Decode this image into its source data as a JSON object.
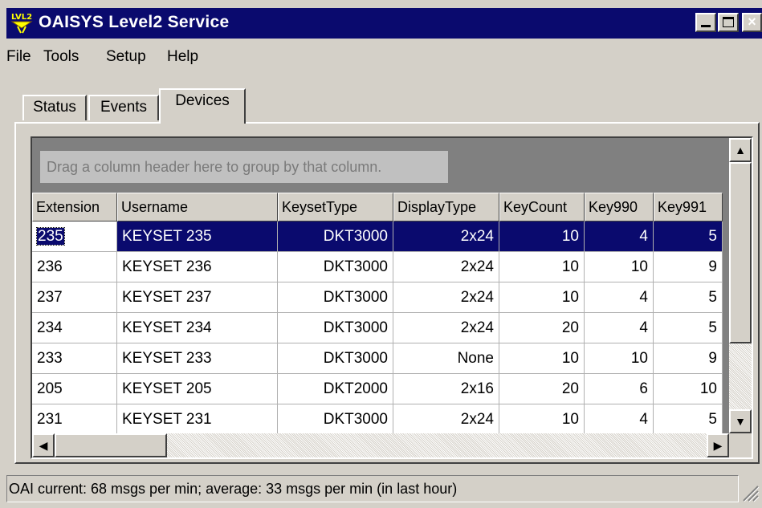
{
  "window": {
    "title": "OAISYS Level2 Service",
    "icon": "lvl2-app-icon",
    "controls": {
      "minimize": "_",
      "maximize": "□",
      "close": "×"
    }
  },
  "menu": {
    "items": [
      "File",
      "Tools",
      "Setup",
      "Help"
    ]
  },
  "tabs": {
    "items": [
      "Status",
      "Events",
      "Devices"
    ],
    "active": "Devices"
  },
  "grid": {
    "group_hint": "Drag a column header here to group by that column.",
    "columns": [
      "Extension",
      "Username",
      "KeysetType",
      "DisplayType",
      "KeyCount",
      "Key990",
      "Key991"
    ],
    "selected_row": 0,
    "rows": [
      [
        "235",
        "KEYSET 235",
        "DKT3000",
        "2x24",
        "10",
        "4",
        "5"
      ],
      [
        "236",
        "KEYSET 236",
        "DKT3000",
        "2x24",
        "10",
        "10",
        "9"
      ],
      [
        "237",
        "KEYSET 237",
        "DKT3000",
        "2x24",
        "10",
        "4",
        "5"
      ],
      [
        "234",
        "KEYSET 234",
        "DKT3000",
        "2x24",
        "20",
        "4",
        "5"
      ],
      [
        "233",
        "KEYSET 233",
        "DKT3000",
        "None",
        "10",
        "10",
        "9"
      ],
      [
        "205",
        "KEYSET 205",
        "DKT2000",
        "2x16",
        "20",
        "6",
        "10"
      ],
      [
        "231",
        "KEYSET 231",
        "DKT3000",
        "2x24",
        "10",
        "4",
        "5"
      ]
    ]
  },
  "scroll": {
    "up": "▲",
    "down": "▼",
    "left": "◀",
    "right": "▶"
  },
  "status": {
    "text": "OAI current: 68 msgs per min; average: 33 msgs per min (in last hour)"
  },
  "colors": {
    "titlebar": "#0a0a6e",
    "face": "#d4d0c8",
    "selection": "#0a0a6e"
  }
}
